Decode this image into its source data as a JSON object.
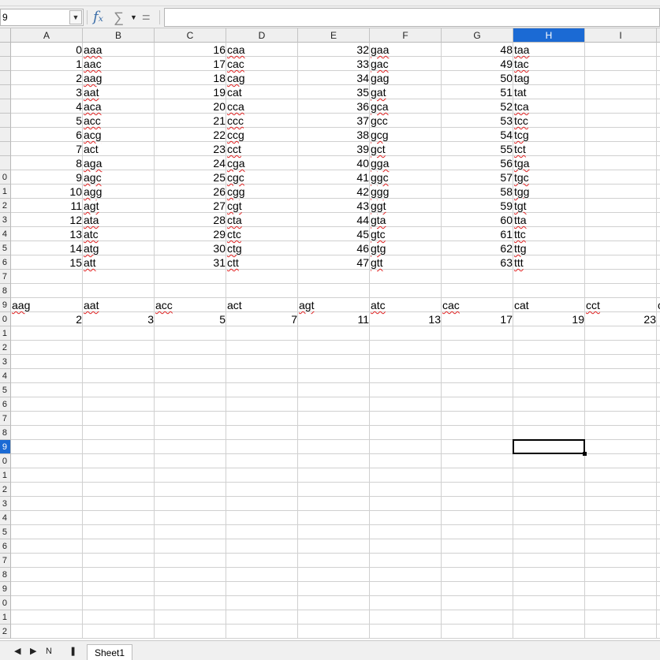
{
  "formula_bar": {
    "name_box": "9",
    "formula": "",
    "icons": [
      "function-wizard-icon",
      "sum-icon",
      "dropdown-arrow-icon",
      "equals-icon"
    ],
    "fx_glyph": "fₓ",
    "sum_glyph": "∑",
    "equals_glyph": "="
  },
  "columns": [
    "A",
    "B",
    "C",
    "D",
    "E",
    "F",
    "G",
    "H",
    "I"
  ],
  "selected_column": "H",
  "row_labels": [
    "",
    "",
    "",
    "",
    "",
    "",
    "",
    "",
    "",
    "0",
    "1",
    "2",
    "3",
    "4",
    "5",
    "6",
    "7",
    "8",
    "9",
    "0",
    "1",
    "2",
    "3",
    "4",
    "5",
    "6",
    "7",
    "8",
    "9",
    "0",
    "1",
    "2",
    "3",
    "4",
    "5",
    "6",
    "7",
    "8",
    "9",
    "0",
    "1",
    "2"
  ],
  "selected_row_label_index": 28,
  "codons": [
    "aaa",
    "aac",
    "aag",
    "aat",
    "aca",
    "acc",
    "acg",
    "act",
    "aga",
    "agc",
    "agg",
    "agt",
    "ata",
    "atc",
    "atg",
    "att",
    "caa",
    "cac",
    "cag",
    "cat",
    "cca",
    "ccc",
    "ccg",
    "cct",
    "cga",
    "cgc",
    "cgg",
    "cgt",
    "cta",
    "ctc",
    "ctg",
    "ctt",
    "gaa",
    "gac",
    "gag",
    "gat",
    "gca",
    "gcc",
    "gcg",
    "gct",
    "gga",
    "ggc",
    "ggg",
    "ggt",
    "gta",
    "gtc",
    "gtg",
    "gtt",
    "taa",
    "tac",
    "tag",
    "tat",
    "tca",
    "tcc",
    "tcg",
    "tct",
    "tga",
    "tgc",
    "tgg",
    "tgt",
    "tta",
    "ttc",
    "ttg",
    "ttt"
  ],
  "indices": [
    "0",
    "1",
    "2",
    "3",
    "4",
    "5",
    "6",
    "7",
    "8",
    "9",
    "10",
    "11",
    "12",
    "13",
    "14",
    "15",
    "16",
    "17",
    "18",
    "19",
    "20",
    "21",
    "22",
    "23",
    "24",
    "25",
    "26",
    "27",
    "28",
    "29",
    "30",
    "31",
    "32",
    "33",
    "34",
    "35",
    "36",
    "37",
    "38",
    "39",
    "40",
    "41",
    "42",
    "43",
    "44",
    "45",
    "46",
    "47",
    "48",
    "49",
    "50",
    "51",
    "52",
    "53",
    "54",
    "55",
    "56",
    "57",
    "58",
    "59",
    "60",
    "61",
    "62",
    "63"
  ],
  "plain_codons": [
    "act",
    "cat",
    "gag",
    "gcc",
    "tag",
    "tat"
  ],
  "prime_header": [
    "aag",
    "aat",
    "acc",
    "act",
    "agt",
    "atc",
    "cac",
    "cat",
    "cct",
    "c"
  ],
  "prime_values": [
    "2",
    "3",
    "5",
    "7",
    "11",
    "13",
    "17",
    "19",
    "23"
  ],
  "sheet_tabs": {
    "nav": [
      "◀",
      "▶",
      "N",
      "❚"
    ],
    "sheet_name": "Sheet1"
  }
}
